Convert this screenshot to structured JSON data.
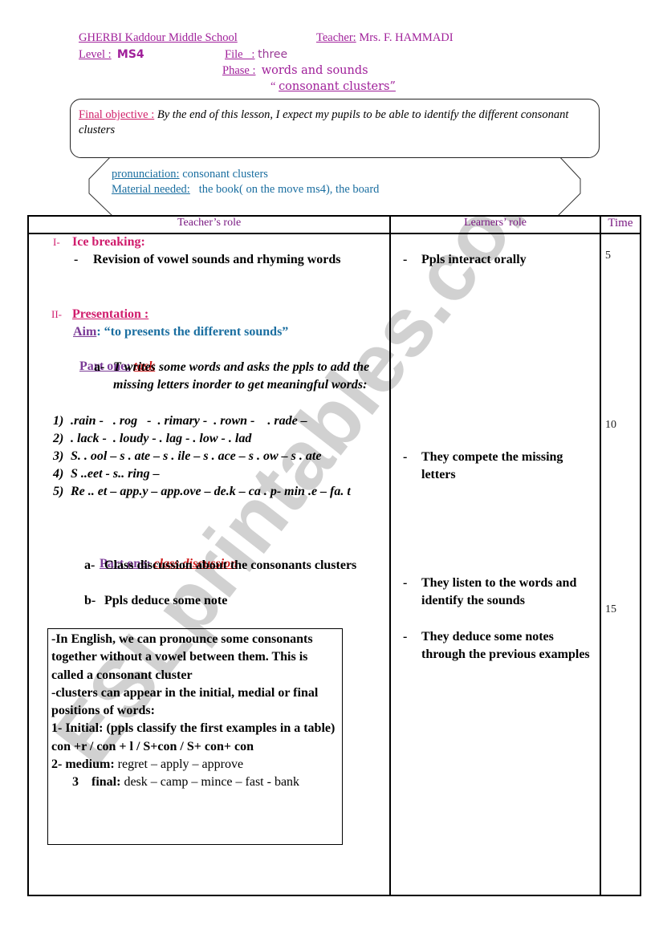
{
  "header": {
    "school": "GHERBI Kaddour Middle School",
    "teacher_label": "Teacher:",
    "teacher_name": " Mrs. F. HAMMADI",
    "level_label": "Level :",
    "level_value": "MS4",
    "file_label": "File   :",
    "file_value": "three",
    "phase_label": "Phase :",
    "phase_value": "words and sounds",
    "phase_sub_open": "“ ",
    "phase_sub": "consonant clusters”"
  },
  "objective": {
    "label": "Final objective :",
    "text": " By the end of this lesson, I expect my pupils to be able to identify the different  consonant clusters"
  },
  "info": {
    "pronunciation_label": "pronunciation:",
    "pronunciation_value": " consonant clusters",
    "material_label": "Material needed:",
    "material_value": "   the book( on the move ms4), the board"
  },
  "table": {
    "headers": [
      "Teacher’s role",
      "Learners’ role",
      "Time"
    ],
    "teacher": {
      "section1_num": "I-",
      "section1_title": "Ice breaking:",
      "section1_bullet": "-",
      "section1_item": "Revision of vowel sounds and rhyming words",
      "section2_num": "II-",
      "section2_title": "Presentation :",
      "aim_label": "Aim",
      "aim_text": ": “to presents the different sounds”",
      "part1_label": "Part one:",
      "part1_task": "task",
      "task_marker": "a-",
      "task_text": "T writes some words and asks the ppls to add the missing letters inorder to get meaningful words:",
      "exercises": [
        {
          "num": "1)",
          "text": ".rain -   . rog   -  . rimary -  . rown -    . rade –"
        },
        {
          "num": "2)",
          "text": ". lack -  . loudy - . lag - . low - . lad"
        },
        {
          "num": "3)",
          "text": "S. . ool – s . ate – s . ile – s . ace – s . ow – s . ate"
        },
        {
          "num": "4)",
          "text": "S ..eet - s.. ring –"
        },
        {
          "num": "5)",
          "text": "Re .. et – app.y – app.ove – de.k – ca . p- min .e – fa. t"
        }
      ],
      "part2_label": "Part one:",
      "part2_task": "class discussion",
      "discussion": [
        {
          "marker": "a-",
          "text": "Class discussion about the consonants clusters"
        },
        {
          "marker": "b-",
          "text": "Ppls deduce some note"
        }
      ],
      "note": {
        "line1": "-In English,  we can pronounce some consonants together without a vowel between them. This is called a consonant cluster",
        "line2": "-clusters can appear in the initial, medial or final positions of words:",
        "initial_label": "1- Initial: ",
        "initial_text": "(ppls classify the first examples in a table) con +r / con + l  /  S+con / S+ con+ con",
        "medium_label": "2- medium: ",
        "medium_text": "regret – apply – approve",
        "final_num": "3",
        "final_label": "final: ",
        "final_text": "desk – camp – mince – fast - bank"
      }
    },
    "learners": [
      {
        "bullet": "-",
        "text": "Ppls interact orally"
      },
      {
        "bullet": "-",
        "text": "They compete the missing letters"
      },
      {
        "bullet": "-",
        "text": "They listen to the words and identify the sounds"
      },
      {
        "bullet": "-",
        "text": "They deduce some notes through the previous examples"
      }
    ],
    "times": [
      "5",
      "10",
      "15"
    ]
  },
  "watermark": "ESLprintables.com",
  "colors": {
    "header_magenta": "#a0209a",
    "objective_pink": "#d01c6c",
    "info_teal": "#1a6ea0",
    "part_purple": "#7a3a96",
    "task_red": "#d01c1c",
    "watermark_gray": "#c8c8c8"
  }
}
